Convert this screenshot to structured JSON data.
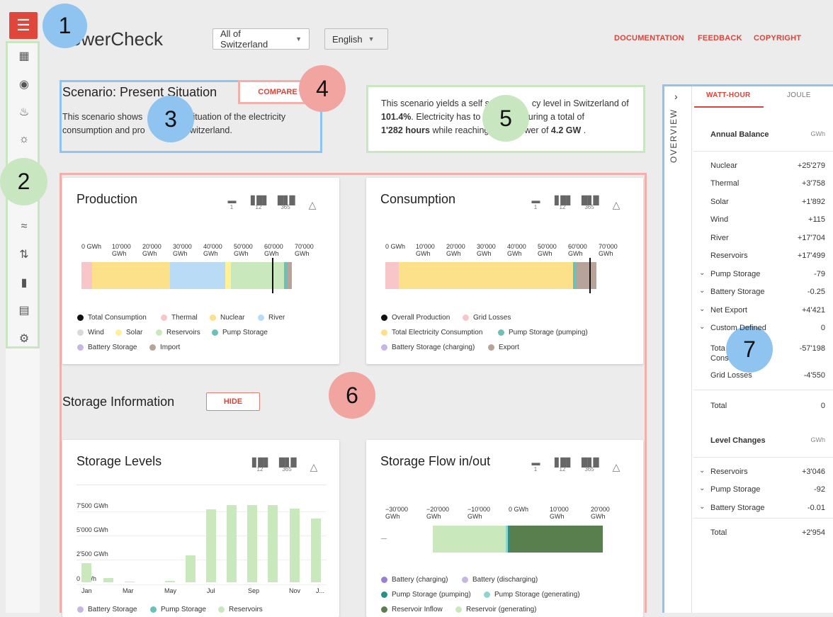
{
  "header": {
    "app_title": "owerCheck",
    "region_select": "All of Switzerland",
    "language_select": "English",
    "links": [
      "DOCUMENTATION",
      "FEEDBACK",
      "COPYRIGHT"
    ]
  },
  "sidebar": {
    "menu_icon": "hamburger-icon",
    "icons": [
      "building-icon",
      "target-icon",
      "flame-icon",
      "sun-icon",
      "wave-icon",
      "transfer-icon",
      "battery-icon",
      "note-add-icon",
      "settings-icon"
    ]
  },
  "scenario": {
    "title": "Scenario: Present Situation",
    "desc_line1": "This scenario shows",
    "desc_line1b": "situation of the electricity",
    "desc_line2": "consumption and pro",
    "desc_line2b": "Switzerland.",
    "compare_label": "COMPARE"
  },
  "summary": {
    "t1": "This scenario yields a self s",
    "t1b": "cy level in Switzerland of",
    "pct": "101.4%",
    "t2": ". Electricity has to",
    "t2b": "d during a total of",
    "hours": "1'282 hours",
    "t3": " while reaching",
    "t3b": "wer of ",
    "power": "4.2 GW",
    "t4": " ."
  },
  "production": {
    "title": "Production",
    "icon_labels": [
      "1",
      "12",
      "365"
    ],
    "axis": [
      [
        "0 GWh",
        ""
      ],
      [
        "10'000",
        "GWh"
      ],
      [
        "20'000",
        "GWh"
      ],
      [
        "30'000",
        "GWh"
      ],
      [
        "40'000",
        "GWh"
      ],
      [
        "50'000",
        "GWh"
      ],
      [
        "60'000",
        "GWh"
      ],
      [
        "70'000",
        "GWh"
      ]
    ],
    "legend": [
      "Total Consumption",
      "Thermal",
      "Nuclear",
      "River",
      "Wind",
      "Solar",
      "Reservoirs",
      "Pump Storage",
      "Battery Storage",
      "Import"
    ]
  },
  "consumption": {
    "title": "Consumption",
    "icon_labels": [
      "1",
      "12",
      "365"
    ],
    "axis": [
      [
        "0 GWh",
        ""
      ],
      [
        "10'000",
        "GWh"
      ],
      [
        "20'000",
        "GWh"
      ],
      [
        "30'000",
        "GWh"
      ],
      [
        "40'000",
        "GWh"
      ],
      [
        "50'000",
        "GWh"
      ],
      [
        "60'000",
        "GWh"
      ],
      [
        "70'000",
        "GWh"
      ]
    ],
    "legend": [
      "Overall Production",
      "Grid Losses",
      "Total Electricity Consumption",
      "Pump Storage (pumping)",
      "Battery Storage (charging)",
      "Export"
    ]
  },
  "storage_info": {
    "title": "Storage Information",
    "hide_label": "HIDE"
  },
  "storage_levels": {
    "title": "Storage Levels",
    "icon_labels": [
      "12",
      "365"
    ],
    "y_ticks": [
      "7'500 GWh",
      "5'000 GWh",
      "2'500 GWh",
      "0 GWh"
    ],
    "months": [
      "Jan",
      "Mar",
      "May",
      "Jul",
      "Sep",
      "Nov",
      "J..."
    ],
    "legend": [
      "Battery Storage",
      "Pump Storage",
      "Reservoirs"
    ]
  },
  "storage_flow": {
    "title": "Storage Flow in/out",
    "icon_labels": [
      "1",
      "12",
      "365"
    ],
    "axis": [
      [
        "−30'000",
        "GWh"
      ],
      [
        "−20'000",
        "GWh"
      ],
      [
        "−10'000",
        "GWh"
      ],
      [
        "0 GWh",
        ""
      ],
      [
        "10'000",
        "GWh"
      ],
      [
        "20'000",
        "GWh"
      ]
    ],
    "legend": [
      "Battery (charging)",
      "Battery (discharging)",
      "Pump Storage (pumping)",
      "Pump Storage (generating)",
      "Reservoir Inflow",
      "Reservoir (generating)"
    ]
  },
  "overview": {
    "label": "OVERVIEW",
    "tabs": [
      "WATT-HOUR",
      "JOULE"
    ],
    "annual": {
      "title": "Annual Balance",
      "unit": "GWh",
      "rows": [
        {
          "label": "Nuclear",
          "value": "+25'279"
        },
        {
          "label": "Thermal",
          "value": "+3'758"
        },
        {
          "label": "Solar",
          "value": "+1'892"
        },
        {
          "label": "Wind",
          "value": "+115"
        },
        {
          "label": "River",
          "value": "+17'704"
        },
        {
          "label": "Reservoirs",
          "value": "+17'499"
        },
        {
          "label": "Pump Storage",
          "value": "-79"
        },
        {
          "label": "Battery Storage",
          "value": "-0.25"
        },
        {
          "label": "Net Export",
          "value": "+4'421"
        },
        {
          "label": "Custom Defined",
          "value": "0"
        },
        {
          "label": "Tota",
          "label2": "Cons",
          "value": "-57'198"
        },
        {
          "label": "Grid Losses",
          "value": "-4'550"
        }
      ],
      "total_label": "Total",
      "total_value": "0"
    },
    "levels": {
      "title": "Level Changes",
      "unit": "GWh",
      "rows": [
        {
          "label": "Reservoirs",
          "value": "+3'046"
        },
        {
          "label": "Pump Storage",
          "value": "-92"
        },
        {
          "label": "Battery Storage",
          "value": "-0.01"
        }
      ],
      "total_label": "Total",
      "total_value": "+2'954"
    }
  },
  "badges": [
    "1",
    "2",
    "3",
    "4",
    "5",
    "6",
    "7"
  ],
  "colors": {
    "accent": "#d9453b",
    "thermal": "#f8c5c8",
    "nuclear": "#fde08a",
    "river": "#b9dbf6",
    "wind": "#d9d9d9",
    "solar": "#fff09a",
    "reservoirs": "#c9e9bd",
    "pump": "#6cc0b8",
    "battery": "#c6b6e4",
    "import": "#b8a39b",
    "total_consumption": "#111111",
    "reservoir_inflow": "#5a7f4e"
  }
}
